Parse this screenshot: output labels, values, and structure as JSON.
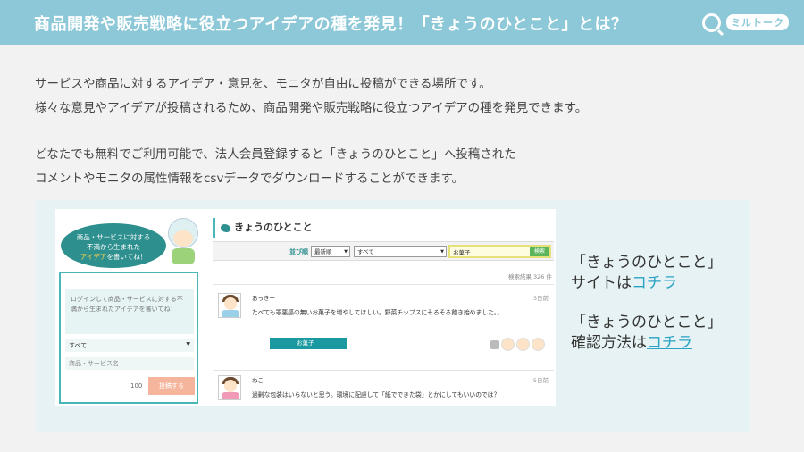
{
  "header": {
    "title": "商品開発や販売戦略に役立つアイデアの種を発見！「きょうのひとこと」とは？",
    "logo_text": "ミルトーク"
  },
  "intro": {
    "line1": "サービスや商品に対するアイデア・意見を、モニタが自由に投稿ができる場所です。",
    "line2": "様々な意見やアイデアが投稿されるため、商品開発や販売戦略に役立つアイデアの種を発見できます。",
    "line3": "どなたでも無料でご利用可能で、法人会員登録すると「きょうのひとこと」へ投稿された",
    "line4": "コメントやモニタの属性情報をcsvデータでダウンロードすることができます。"
  },
  "screenshot": {
    "bubble_line1": "商品・サービスに対する",
    "bubble_line2": "不満から生まれた",
    "bubble_line3_em": "アイデア",
    "bubble_line3_rest": "を書いてね！",
    "textarea_placeholder": "ログインして商品・サービスに対する不満から生まれたアイデアを書いてね！",
    "category_value": "すべて",
    "product_placeholder": "商品・サービス名",
    "char_count": "100",
    "post_button": "投稿する",
    "title": "きょうのひとこと",
    "sort_label": "並び順",
    "sort_value": "最新順",
    "filter_value": "すべて",
    "search_value": "お菓子",
    "search_button": "検索",
    "result_text": "検索結果 326 件",
    "posts": [
      {
        "user": "あっきー",
        "date": "3日前",
        "text": "たべても罪悪感の無いお菓子を増やしてほしい。野菜チップスにそろそろ飽き始めました。。",
        "tag": "お菓子"
      },
      {
        "user": "ねこ",
        "date": "5日前",
        "text": "過剰な包装はいらないと思う。環境に配慮して「紙でできた袋」とかにしてもいいのでは？"
      }
    ]
  },
  "side": {
    "block1_line1": "「きょうのひとこと」",
    "block1_prefix": "サイトは",
    "block1_link": "コチラ",
    "block2_line1": "「きょうのひとこと」",
    "block2_prefix": "確認方法は",
    "block2_link": "コチラ"
  },
  "colors": {
    "header_bg": "#8cc8d7",
    "accent": "#49b7b7",
    "link": "#2aa3c4"
  }
}
